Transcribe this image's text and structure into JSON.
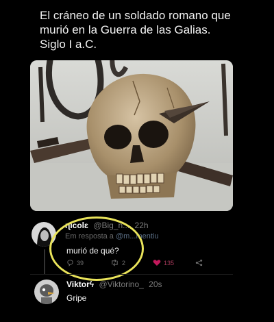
{
  "caption": {
    "line1": "El cráneo de un soldado romano que",
    "line2": "murió en la Guerra de las Galias.",
    "line3": "Siglo I a.C."
  },
  "photo": {
    "subject": "skull-with-embedded-spear"
  },
  "reply1": {
    "name": "ɳicolɛ",
    "handle": "@Big_n...",
    "time": "22h",
    "reply_prefix": "Em resposta a",
    "reply_mention": "@m...mentiu",
    "text": "murió de qué?",
    "replies": "39",
    "retweets": "2",
    "likes": "135",
    "icons": [
      "reply-icon",
      "retweet-icon",
      "heart-icon",
      "share-icon"
    ]
  },
  "reply2": {
    "name": "Viktorϟ",
    "handle": "@Viktorino_",
    "time": "20s",
    "text": "Gripe"
  },
  "colors": {
    "background": "#000000",
    "highlight": "#e9e35a",
    "like": "#c2185b",
    "muted": "#7b7b7b"
  }
}
